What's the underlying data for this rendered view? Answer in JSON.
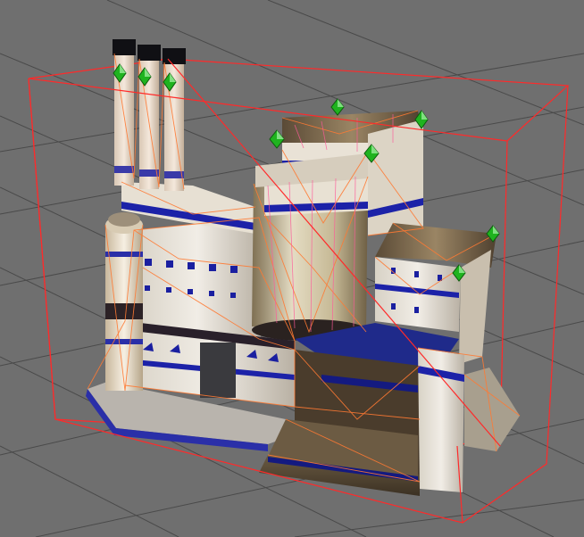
{
  "viewport": {
    "background": "#6f6f6f",
    "grid_color": "#4a4a4a",
    "bbox_color": "#ff2a2a",
    "wire_color": "#ff7a33",
    "marker_color": "#19a319"
  },
  "icons": {
    "marker": "green-pivot-marker-icon"
  }
}
